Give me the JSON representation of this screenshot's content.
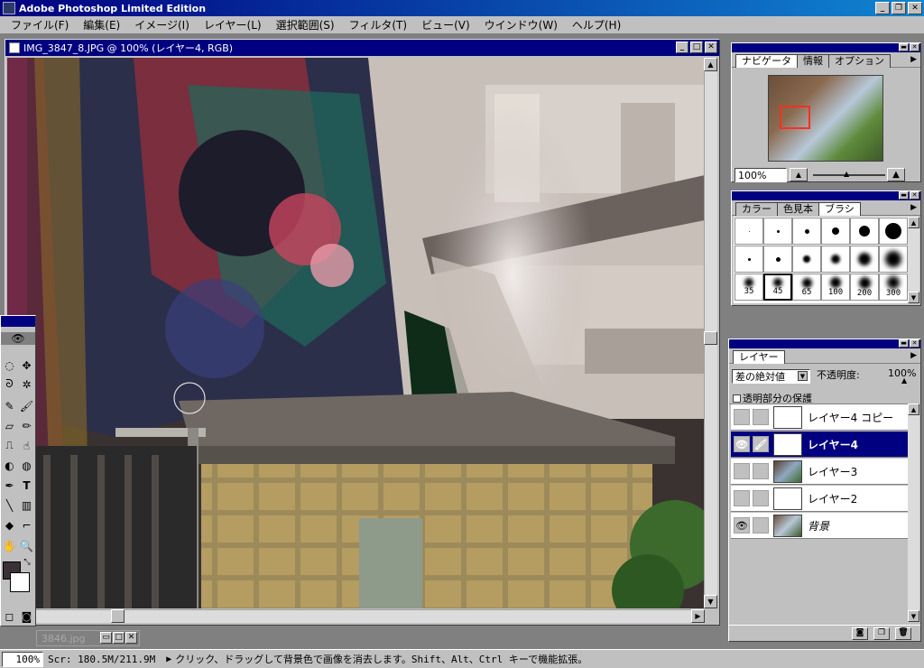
{
  "app": {
    "title": "Adobe Photoshop Limited Edition"
  },
  "menu": [
    "ファイル(F)",
    "編集(E)",
    "イメージ(I)",
    "レイヤー(L)",
    "選択範囲(S)",
    "フィルタ(T)",
    "ビュー(V)",
    "ウインドウ(W)",
    "ヘルプ(H)"
  ],
  "document": {
    "title": "IMG_3847_8.JPG @ 100% (レイヤー4, RGB)"
  },
  "navigator": {
    "tabs": [
      "ナビゲータ",
      "情報",
      "オプション"
    ],
    "zoom": "100%"
  },
  "brushes": {
    "tabs": [
      "カラー",
      "色見本",
      "ブラシ"
    ],
    "sizes": [
      "35",
      "45",
      "65",
      "100",
      "200",
      "300"
    ]
  },
  "layers": {
    "tab": "レイヤー",
    "blend_mode": "差の絶対値",
    "opacity_label": "不透明度:",
    "opacity_value": "100%",
    "preserve_label": "透明部分の保護",
    "items": [
      "レイヤー4 コピー",
      "レイヤー4",
      "レイヤー3",
      "レイヤー2",
      "背景"
    ]
  },
  "taskbar": {
    "minimized_doc": "3846.jpg"
  },
  "status": {
    "zoom": "100%",
    "scratch": "Scr: 180.5M/211.9M",
    "hint": "クリック、ドラッグして背景色で画像を消去します。Shift、Alt、Ctrl キーで機能拡張。"
  },
  "colors": {
    "title_bar": "#000080",
    "chrome": "#c0c0c0",
    "foreground": "#3a3038",
    "background": "#ffffff"
  },
  "icons": [
    "photoshop-app-icon",
    "minimize-icon",
    "restore-icon",
    "close-icon",
    "eye-icon",
    "brush-icon",
    "trash-icon",
    "new-layer-icon",
    "layer-mask-icon"
  ]
}
